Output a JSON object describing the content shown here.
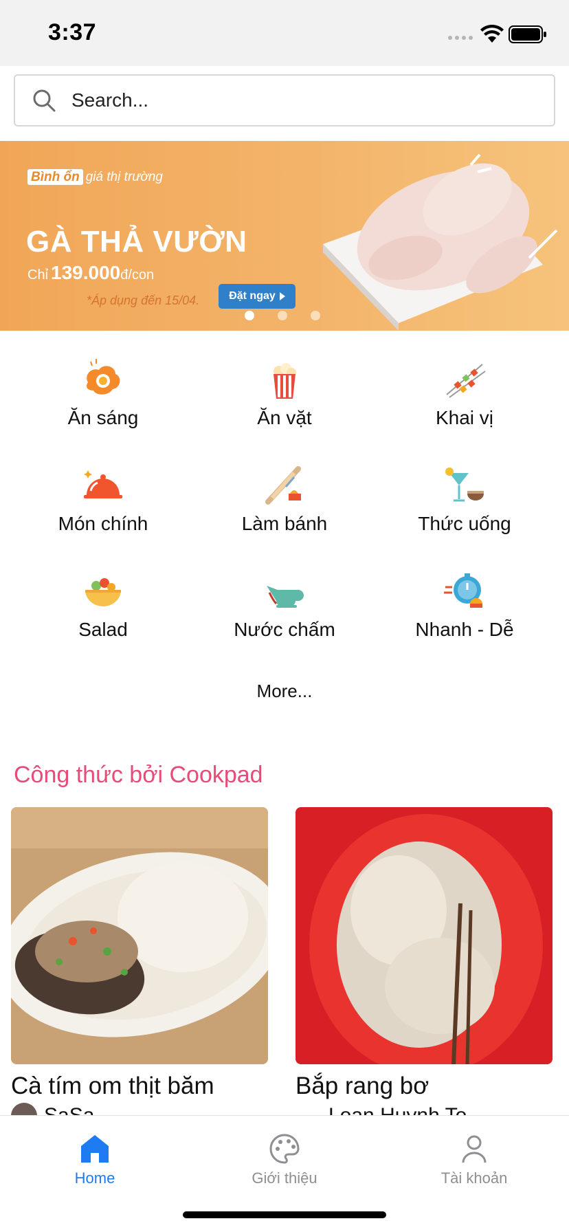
{
  "status_bar": {
    "time": "3:37"
  },
  "search": {
    "placeholder": "Search..."
  },
  "banner": {
    "tag_highlight": "Bình ổn",
    "tag_rest": "giá thị trường",
    "title": "GÀ THẢ VƯỜN",
    "price_prefix": "Chỉ",
    "price": "139.000",
    "price_suffix": "đ/con",
    "valid_until": "*Áp dụng đến 15/04.",
    "cta_label": "Đặt ngay",
    "active_slide": 1,
    "slide_count": 3
  },
  "categories": [
    {
      "label": "Ăn sáng",
      "icon": "fried-egg-icon"
    },
    {
      "label": "Ăn vặt",
      "icon": "popcorn-icon"
    },
    {
      "label": "Khai vị",
      "icon": "skewer-icon"
    },
    {
      "label": "Món chính",
      "icon": "cloche-icon"
    },
    {
      "label": "Làm bánh",
      "icon": "rolling-pin-icon"
    },
    {
      "label": "Thức uống",
      "icon": "cocktail-icon"
    },
    {
      "label": "Salad",
      "icon": "salad-bowl-icon"
    },
    {
      "label": "Nước chấm",
      "icon": "gravy-boat-icon"
    },
    {
      "label": "Nhanh - Dễ",
      "icon": "stopwatch-icon"
    }
  ],
  "more_label": "More...",
  "section": {
    "title": "Công thức bởi Cookpad"
  },
  "recipes": [
    {
      "title": "Cà tím om thịt băm",
      "author": "SaSa"
    },
    {
      "title": "Bắp rang bơ",
      "author": "Loan Huynh To"
    }
  ],
  "tabs": [
    {
      "label": "Home",
      "icon": "home-icon",
      "active": true
    },
    {
      "label": "Giới thiệu",
      "icon": "palette-icon",
      "active": false
    },
    {
      "label": "Tài khoản",
      "icon": "user-icon",
      "active": false
    }
  ],
  "colors": {
    "accent": "#1e7bf2",
    "section_title": "#e74c78",
    "banner_bg": "#f3b46a"
  }
}
